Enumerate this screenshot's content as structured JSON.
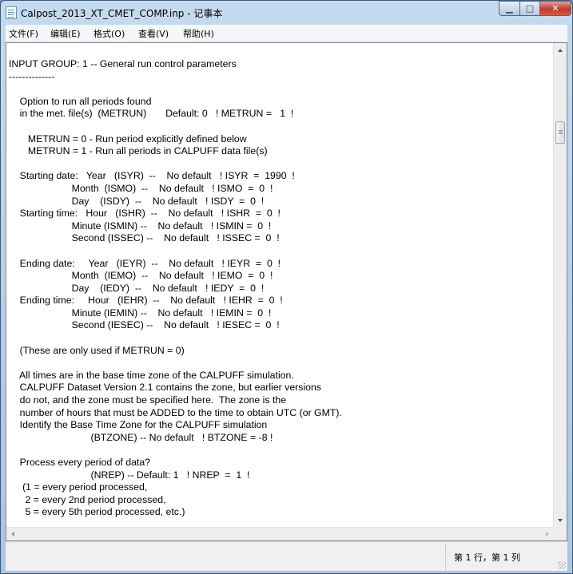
{
  "window": {
    "title": "Calpost_2013_XT_CMET_COMP.inp - 记事本",
    "minimize_glyph": "▁",
    "maximize_glyph": "□",
    "close_glyph": "✕"
  },
  "menu": {
    "items": [
      "文件(F)",
      "编辑(E)",
      "格式(O)",
      "查看(V)",
      "帮助(H)"
    ]
  },
  "editor": {
    "lines": [
      "INPUT GROUP: 1 -- General run control parameters",
      "--------------",
      "",
      "    Option to run all periods found",
      "    in the met. file(s)  (METRUN)       Default: 0   ! METRUN =   1  !",
      "",
      "       METRUN = 0 - Run period explicitly defined below",
      "       METRUN = 1 - Run all periods in CALPUFF data file(s)",
      "",
      "    Starting date:   Year   (ISYR)  --    No default   ! ISYR  =  1990  !",
      "                       Month  (ISMO)  --    No default   ! ISMO  =  0  !",
      "                       Day    (ISDY)  --    No default   ! ISDY  =  0  !",
      "    Starting time:   Hour   (ISHR)  --    No default   ! ISHR  =  0  !",
      "                       Minute (ISMIN) --    No default   ! ISMIN =  0  !",
      "                       Second (ISSEC) --    No default   ! ISSEC =  0  !",
      "",
      "    Ending date:     Year   (IEYR)  --    No default   ! IEYR  =  0  !",
      "                       Month  (IEMO)  --    No default   ! IEMO  =  0  !",
      "                       Day    (IEDY)  --    No default   ! IEDY  =  0  !",
      "    Ending time:     Hour   (IEHR)  --    No default   ! IEHR  =  0  !",
      "                       Minute (IEMIN) --    No default   ! IEMIN =  0  !",
      "                       Second (IESEC) --    No default   ! IESEC =  0  !",
      "",
      "    (These are only used if METRUN = 0)",
      "",
      "    All times are in the base time zone of the CALPUFF simulation.",
      "    CALPUFF Dataset Version 2.1 contains the zone, but earlier versions",
      "    do not, and the zone must be specified here.  The zone is the",
      "    number of hours that must be ADDED to the time to obtain UTC (or GMT).",
      "    Identify the Base Time Zone for the CALPUFF simulation",
      "                              (BTZONE) -- No default   ! BTZONE = -8 !",
      "",
      "    Process every period of data?",
      "                              (NREP) -- Default: 1   ! NREP  =  1  !",
      "     (1 = every period processed,",
      "      2 = every 2nd period processed,",
      "      5 = every 5th period processed, etc.)"
    ]
  },
  "status": {
    "position": "第 1 行，第 1 列"
  }
}
